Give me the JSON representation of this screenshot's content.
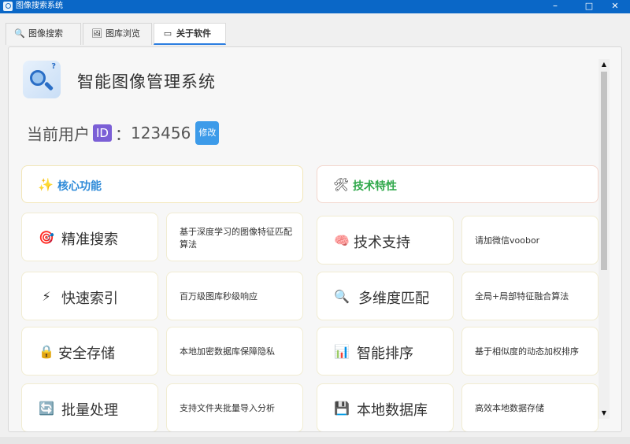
{
  "window": {
    "title": "图像搜索系统",
    "controls": {
      "minimize": "–",
      "maximize": "□",
      "close": "✕"
    }
  },
  "tabs": [
    {
      "label": "图像搜索",
      "icon": "search-icon",
      "active": false
    },
    {
      "label": "图库浏览",
      "icon": "image-gallery-icon",
      "active": false
    },
    {
      "label": "关于软件",
      "icon": "info-book-icon",
      "active": true
    }
  ],
  "about": {
    "app_title": "智能图像管理系统",
    "user": {
      "prefix": "当前用户",
      "id_badge": "ID",
      "separator": "：",
      "id_value": "123456",
      "edit_label": "修改"
    },
    "core": {
      "header": "核心功能",
      "header_icon": "sparkle-icon",
      "header_color": "#2d8ad8",
      "items": [
        {
          "title": "精准搜索",
          "icon": "target-icon",
          "desc": "基于深度学习的图像特征匹配算法"
        },
        {
          "title": "快速索引",
          "icon": "lightning-icon",
          "desc": "百万级图库秒级响应"
        },
        {
          "title": "安全存储",
          "icon": "lock-icon",
          "desc": "本地加密数据库保障隐私"
        },
        {
          "title": "批量处理",
          "icon": "refresh-icon",
          "desc": "支持文件夹批量导入分析"
        }
      ]
    },
    "tech": {
      "header": "技术特性",
      "header_icon": "tools-icon",
      "header_color": "#2fa84a",
      "items": [
        {
          "title": "技术支持",
          "icon": "brain-icon",
          "desc": "请加微信voobor"
        },
        {
          "title": "多维度匹配",
          "icon": "magnifier-icon",
          "desc": "全局+局部特征融合算法"
        },
        {
          "title": "智能排序",
          "icon": "bar-chart-icon",
          "desc": "基于相似度的动态加权排序"
        },
        {
          "title": "本地数据库",
          "icon": "floppy-disk-icon",
          "desc": "高效本地数据存储"
        }
      ]
    }
  }
}
